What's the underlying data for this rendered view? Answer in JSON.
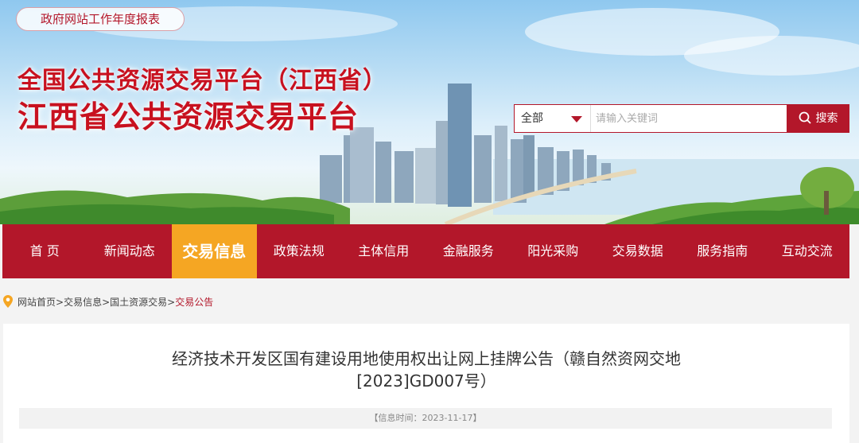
{
  "header": {
    "report_link": "政府网站工作年度报表",
    "title_line1": "全国公共资源交易平台（江西省）",
    "title_line2": "江西省公共资源交易平台"
  },
  "search": {
    "scope_selected": "全部",
    "placeholder": "请输入关键词",
    "button_label": "搜索"
  },
  "nav": {
    "items": [
      "首 页",
      "新闻动态",
      "交易信息",
      "政策法规",
      "主体信用",
      "金融服务",
      "阳光采购",
      "交易数据",
      "服务指南",
      "互动交流"
    ],
    "active_index": 2
  },
  "breadcrumb": {
    "items": [
      "网站首页",
      "交易信息",
      "国土资源交易",
      "交易公告"
    ],
    "separator": ">"
  },
  "article": {
    "title_line1": "经济技术开发区国有建设用地使用权出让网上挂牌公告（赣自然资网交地",
    "title_line2": "[2023]GD007号）",
    "meta_label": "【信息时间：",
    "meta_date": "2023-11-17",
    "meta_end": "】"
  },
  "colors": {
    "primary_red": "#b3172a",
    "active_orange": "#f5a623"
  },
  "icons": {
    "search": "magnifier-icon",
    "location": "map-pin-icon",
    "dropdown": "triangle-down-icon"
  }
}
